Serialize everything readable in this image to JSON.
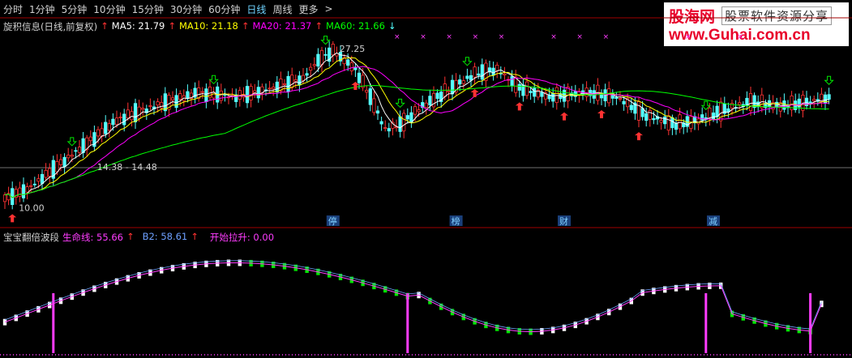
{
  "toolbar": {
    "items": [
      {
        "label": "分时"
      },
      {
        "label": "1分钟"
      },
      {
        "label": "5分钟"
      },
      {
        "label": "10分钟"
      },
      {
        "label": "15分钟"
      },
      {
        "label": "30分钟"
      },
      {
        "label": "60分钟"
      },
      {
        "label": "日线"
      },
      {
        "label": "周线"
      },
      {
        "label": "更多"
      },
      {
        "label": ">"
      }
    ]
  },
  "logo": {
    "brand": "股海网",
    "slogan": "股票软件资源分享",
    "url": "www.Guhai.com.cn"
  },
  "colors": {
    "up": "#ff3232",
    "down": "#54ffff",
    "ma5": "#ffffff",
    "ma10": "#ffff00",
    "ma20": "#ff00ff",
    "ma60": "#00ff00",
    "life": "#ff3cff",
    "b2": "#6ea0ff",
    "green": "#00e600",
    "white": "#ffffff"
  },
  "main_legend": {
    "name": "旋积信息(日线,前复权)",
    "ma5": "MA5: 21.79",
    "ma10": "MA10: 21.18",
    "ma20": "MA20: 21.37",
    "ma60": "MA60: 21.66"
  },
  "sub_legend": {
    "name": "宝宝翻倍波段",
    "life": "生命线: 55.66",
    "b2": "B2: 58.61",
    "start": "开始拉升: 0.00"
  },
  "chart_data": {
    "type": "candlestick",
    "main": {
      "ylim": [
        9,
        29
      ],
      "annotations": [
        {
          "text": "27.25",
          "x": 88,
          "y": 27.25
        },
        {
          "text": "14.38 - 14.48",
          "x": 23,
          "y": 14.43
        },
        {
          "text": "10.00",
          "x": 2,
          "y": 10.0
        }
      ],
      "price_level": 14.7,
      "event_markers": [
        {
          "text": "停",
          "x": 88
        },
        {
          "text": "榜",
          "x": 121
        },
        {
          "text": "财",
          "x": 150
        },
        {
          "text": "减",
          "x": 190
        }
      ],
      "candles_summary": "Daily candles rising from ~10.00 to peak ~27.25, then consolidating around 19–23; MA5/MA10/MA20/MA60 overlays"
    },
    "sub": {
      "ylim": [
        0,
        100
      ],
      "life_line_value": 55.66,
      "b2_value": 58.61,
      "start_signal_value": 0.0,
      "start_signals_x": [
        13,
        108,
        188,
        216
      ]
    }
  }
}
